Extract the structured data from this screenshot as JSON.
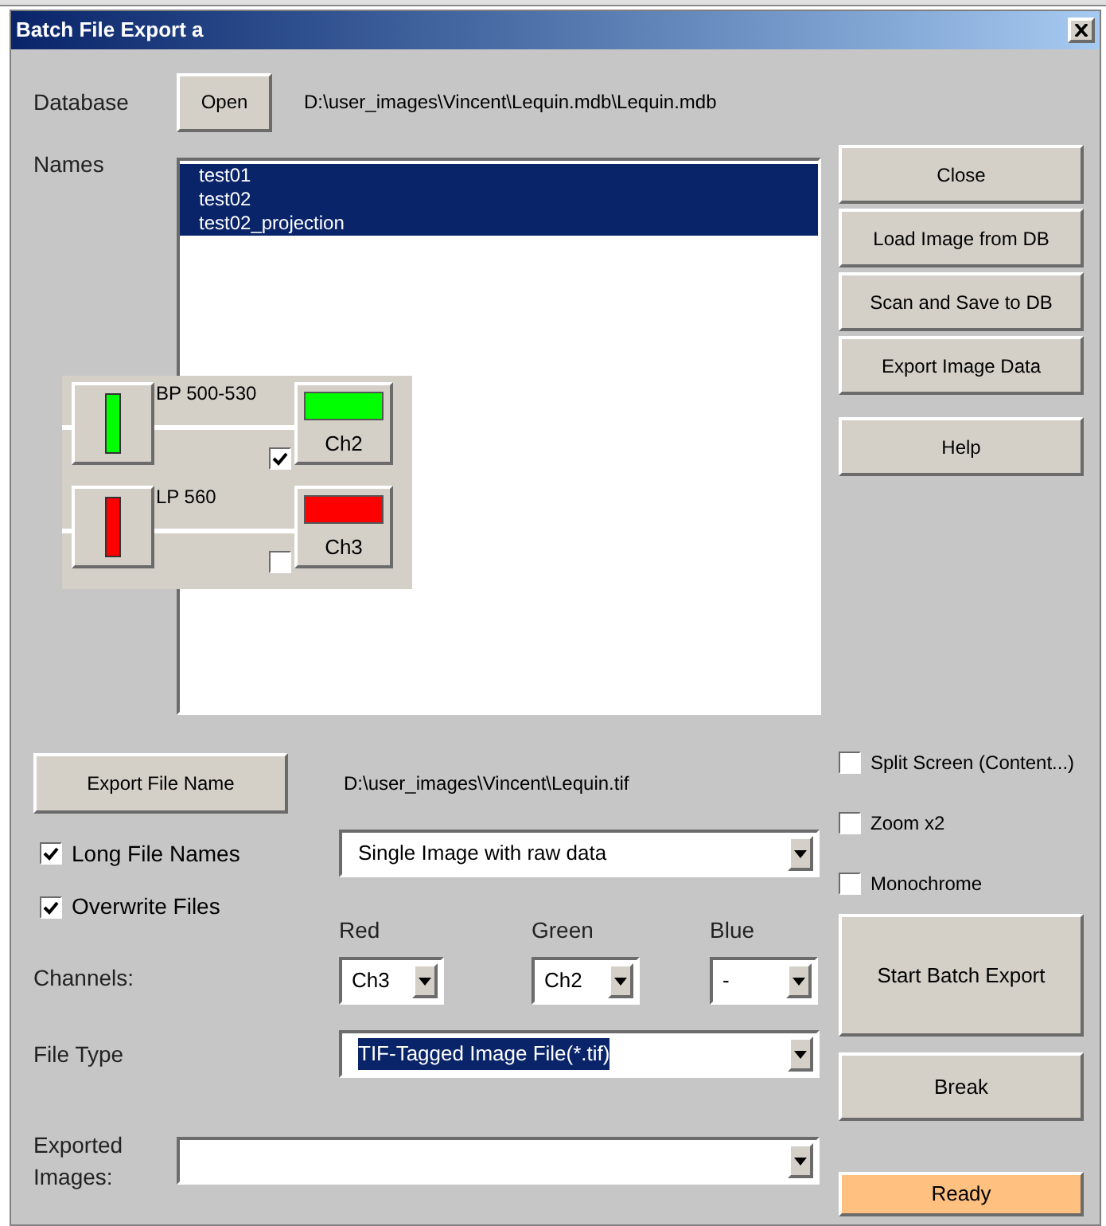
{
  "window": {
    "title": "Batch File Export a"
  },
  "database": {
    "label": "Database",
    "open_button": "Open",
    "path": "D:\\user_images\\Vincent\\Lequin.mdb\\Lequin.mdb"
  },
  "names": {
    "label": "Names",
    "items": [
      {
        "text": "test01",
        "selected": true
      },
      {
        "text": "test02",
        "selected": true
      },
      {
        "text": "test02_projection",
        "selected": true
      }
    ]
  },
  "filters": [
    {
      "name": "BP 500-530",
      "color": "#00ff00",
      "checked": true,
      "channel": "Ch2"
    },
    {
      "name": "LP 560",
      "color": "#ff0000",
      "checked": false,
      "channel": "Ch3"
    }
  ],
  "side_buttons": [
    "Close",
    "Load Image from DB",
    "Scan and Save to DB",
    "Export Image Data",
    "Help"
  ],
  "export_file": {
    "button": "Export File Name",
    "path": "D:\\user_images\\Vincent\\Lequin.tif"
  },
  "options": [
    {
      "label": "Split Screen (Content...)",
      "checked": false
    },
    {
      "label": "Zoom x2",
      "checked": false
    },
    {
      "label": "Monochrome",
      "checked": false
    }
  ],
  "long_file_names": {
    "label": "Long File Names",
    "checked": true
  },
  "overwrite_files": {
    "label": "Overwrite Files",
    "checked": true
  },
  "mode": {
    "value": "Single Image with raw data"
  },
  "channels": {
    "label": "Channels:",
    "selects": [
      {
        "label": "Red",
        "value": "Ch3"
      },
      {
        "label": "Green",
        "value": "Ch2"
      },
      {
        "label": "Blue",
        "value": "-"
      }
    ]
  },
  "file_type": {
    "label": "File Type",
    "value": "TIF-Tagged Image File(*.tif)",
    "highlighted": true
  },
  "exported_images": {
    "label": "Exported Images:"
  },
  "start_button": "Start Batch Export",
  "break_button": "Break",
  "status": "Ready"
}
